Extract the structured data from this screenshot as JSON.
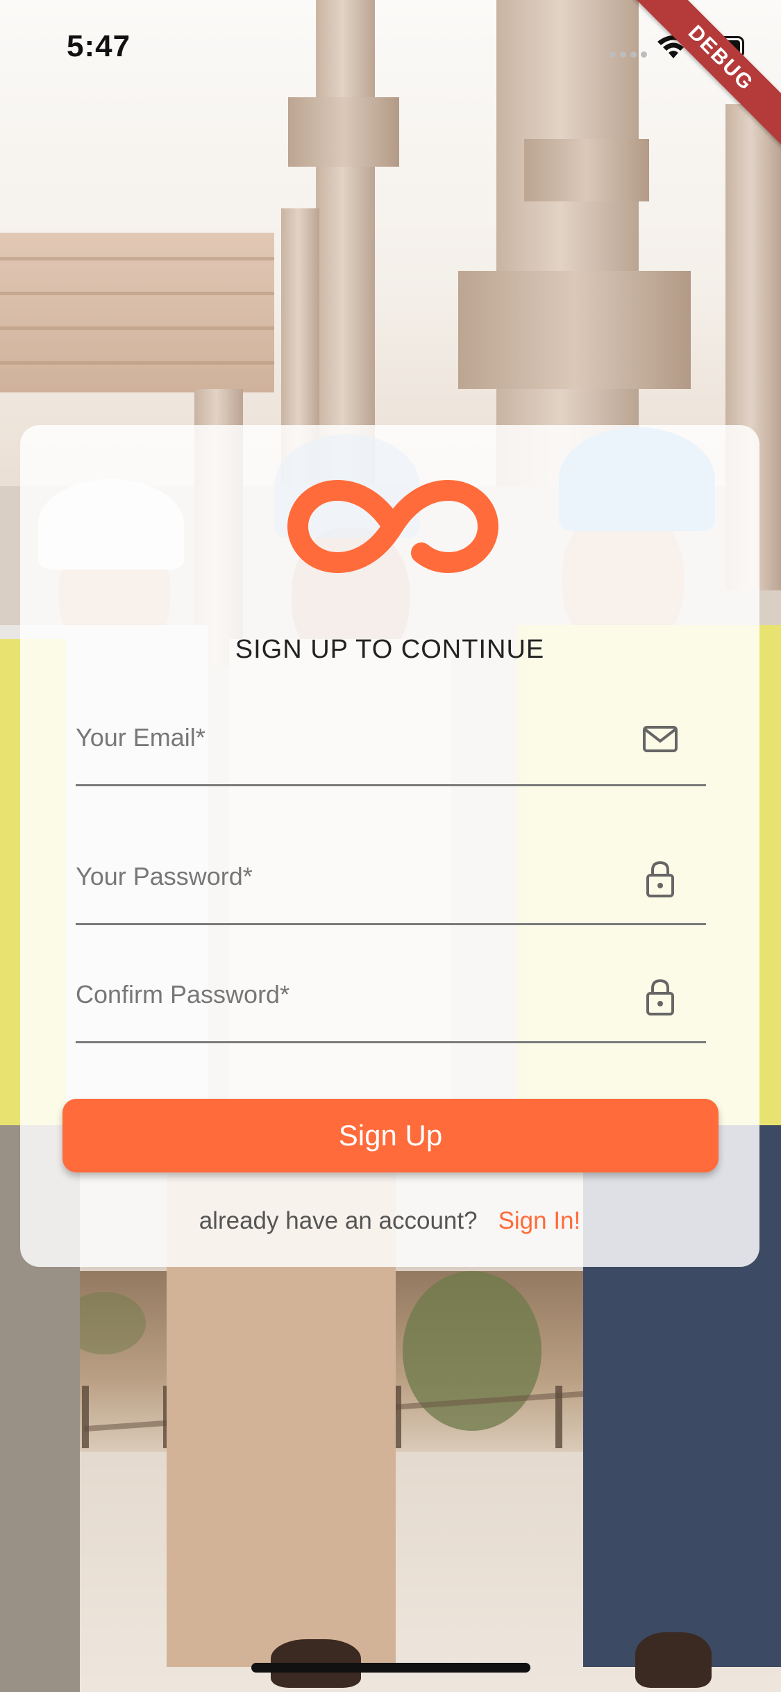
{
  "status_bar": {
    "time": "5:47",
    "debug_label": "DEBUG",
    "icons": [
      "signal-icon",
      "wifi-icon",
      "battery-icon"
    ]
  },
  "brand": {
    "logo_icon": "infinity-logo-icon",
    "accent_color": "#ff6b3a"
  },
  "form": {
    "heading": "SIGN UP TO CONTINUE",
    "email": {
      "placeholder": "Your Email*",
      "value": "",
      "icon": "envelope-icon"
    },
    "password": {
      "placeholder": "Your Password*",
      "value": "",
      "icon": "lock-icon"
    },
    "confirm_password": {
      "placeholder": "Confirm Password*",
      "value": "",
      "icon": "lock-icon"
    },
    "submit_label": "Sign Up"
  },
  "footer": {
    "prompt": "already have an account?",
    "link_label": "Sign In!"
  }
}
